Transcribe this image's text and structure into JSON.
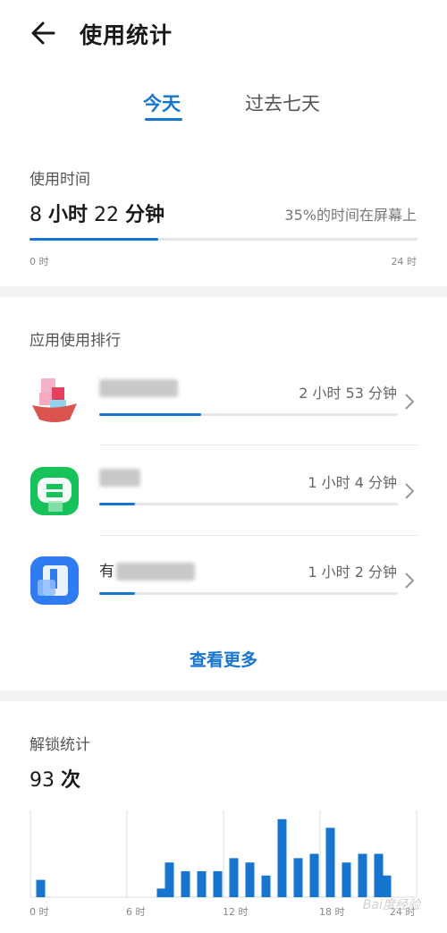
{
  "header": {
    "title": "使用统计"
  },
  "tabs": [
    {
      "label": "今天",
      "active": true
    },
    {
      "label": "过去七天",
      "active": false
    }
  ],
  "usage": {
    "section_label": "使用时间",
    "hours": "8",
    "hours_unit": "小时",
    "minutes": "22",
    "minutes_unit": "分钟",
    "screen_ratio_text": "35%的时间在屏幕上",
    "progress_fraction": 0.35,
    "axis_start": "0 时",
    "axis_end": "24 时"
  },
  "apps": {
    "section_label": "应用使用排行",
    "items": [
      {
        "name_prefix": "",
        "time": "2 小时 53 分钟",
        "progress_fraction": 0.34,
        "icon": "app-icon-blurred-pink"
      },
      {
        "name_prefix": "",
        "time": "1 小时 4 分钟",
        "progress_fraction": 0.12,
        "icon": "app-icon-green-chat"
      },
      {
        "name_prefix": "有",
        "time": "1 小时 2 分钟",
        "progress_fraction": 0.12,
        "icon": "app-icon-blue-note"
      }
    ],
    "more_label": "查看更多"
  },
  "unlock": {
    "section_label": "解锁统计",
    "count": "93",
    "count_unit": "次"
  },
  "chart_data": {
    "type": "bar",
    "title": "",
    "xlabel": "",
    "ylabel": "",
    "x_tick_labels": [
      "0 时",
      "6 时",
      "12 时",
      "18 时",
      "24 时"
    ],
    "x_range": [
      0,
      24
    ],
    "bar_color": "#1675d1",
    "grid": "vertical-at-6h",
    "x": [
      0.25,
      7.75,
      8.25,
      9.25,
      10.25,
      11.25,
      12.25,
      13.25,
      14.25,
      15.25,
      16.25,
      17.25,
      18.25,
      19.25,
      20.25,
      21.25,
      21.75
    ],
    "values": [
      2,
      1,
      4,
      3,
      3,
      3,
      4.5,
      4,
      2.5,
      9,
      4.5,
      5,
      8,
      4,
      5,
      5,
      2.5
    ]
  },
  "watermark": "Bai度经验"
}
